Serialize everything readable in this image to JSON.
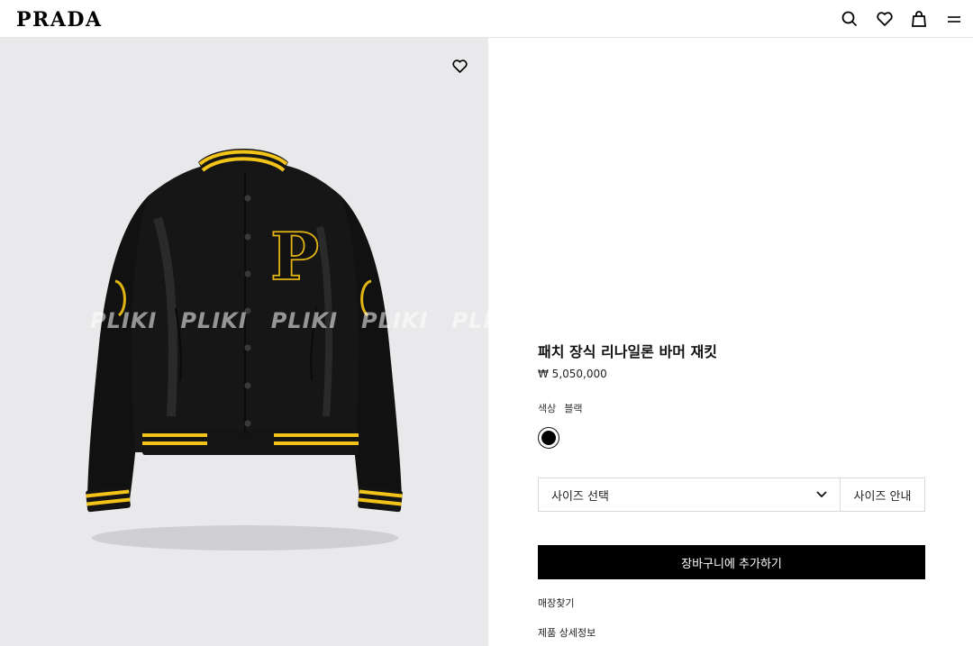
{
  "header": {
    "logo": "PRADA",
    "icons": [
      "search-icon",
      "heart-icon",
      "bag-icon",
      "menu-icon"
    ]
  },
  "gallery": {
    "watermark": [
      "PLIKI",
      "PLIKI",
      "PLIKI",
      "PLIKI",
      "PLI"
    ],
    "favorite_icon": "heart-icon",
    "background": "#e9e9eb"
  },
  "product": {
    "title": "패치 장식 리나일론 바머 재킷",
    "price": "₩ 5,050,000",
    "color_label": "색상",
    "color_value": "블랙",
    "swatch_color": "#000000",
    "size_select_label": "사이즈 선택",
    "size_guide_label": "사이즈 안내",
    "add_to_cart_label": "장바구니에 추가하기",
    "store_link": "매장찾기",
    "details_link": "제품 상세정보"
  },
  "colors": {
    "accent": "#000000",
    "stripe": "#f2c318"
  }
}
